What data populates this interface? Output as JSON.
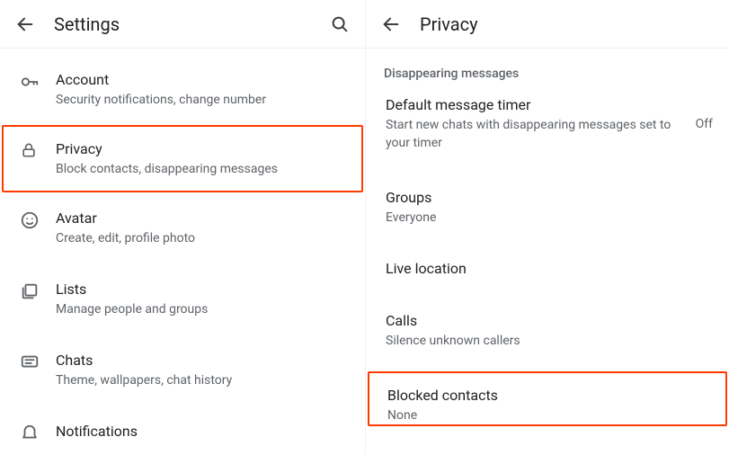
{
  "left": {
    "title": "Settings",
    "items": [
      {
        "icon": "key-icon",
        "title": "Account",
        "sub": "Security notifications, change number",
        "highlight": false
      },
      {
        "icon": "lock-icon",
        "title": "Privacy",
        "sub": "Block contacts, disappearing messages",
        "highlight": true
      },
      {
        "icon": "avatar-icon",
        "title": "Avatar",
        "sub": "Create, edit, profile photo",
        "highlight": false
      },
      {
        "icon": "lists-icon",
        "title": "Lists",
        "sub": "Manage people and groups",
        "highlight": false
      },
      {
        "icon": "chats-icon",
        "title": "Chats",
        "sub": "Theme, wallpapers, chat history",
        "highlight": false
      },
      {
        "icon": "notifications-icon",
        "title": "Notifications",
        "sub": "",
        "highlight": false
      }
    ]
  },
  "right": {
    "title": "Privacy",
    "section_header": "Disappearing messages",
    "items": [
      {
        "title": "Default message timer",
        "sub": "Start new chats with disappearing messages set to your timer",
        "trailing": "Off",
        "highlight": false
      },
      {
        "title": "Groups",
        "sub": "Everyone",
        "trailing": "",
        "highlight": false
      },
      {
        "title": "Live location",
        "sub": "",
        "trailing": "",
        "highlight": false
      },
      {
        "title": "Calls",
        "sub": "Silence unknown callers",
        "trailing": "",
        "highlight": false
      },
      {
        "title": "Blocked contacts",
        "sub": "None",
        "trailing": "",
        "highlight": true
      }
    ]
  }
}
